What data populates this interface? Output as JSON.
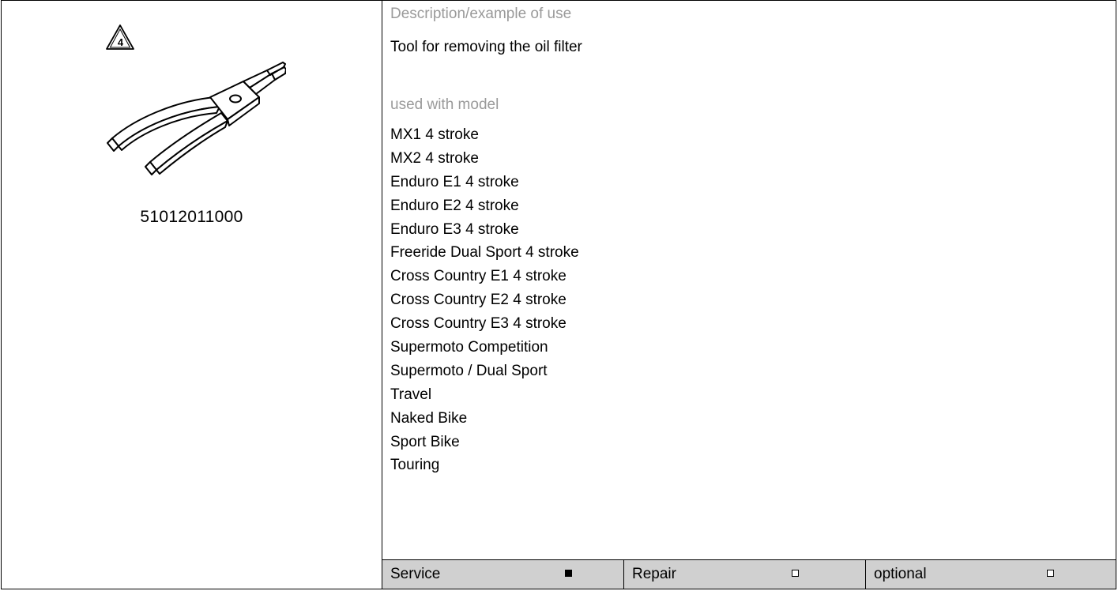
{
  "tool": {
    "part_number": "51012011000",
    "warning_symbol_number": "4",
    "description_heading": "Description/example of use",
    "description": "Tool for removing the oil filter",
    "models_heading": "used with model",
    "models": [
      "MX1 4 stroke",
      "MX2 4 stroke",
      "Enduro E1 4 stroke",
      "Enduro E2 4 stroke",
      "Enduro E3 4 stroke",
      "Freeride Dual Sport 4 stroke",
      "Cross Country E1 4 stroke",
      "Cross Country E2 4 stroke",
      "Cross Country E3 4 stroke",
      "Supermoto Competition",
      "Supermoto / Dual Sport",
      "Travel",
      "Naked Bike",
      "Sport Bike",
      "Touring"
    ]
  },
  "usage": {
    "service_label": "Service",
    "service_checked": true,
    "repair_label": "Repair",
    "repair_checked": false,
    "optional_label": "optional",
    "optional_checked": false
  },
  "icons": {
    "warning": "warning-triangle-icon",
    "tool": "circlip-pliers-illustration"
  },
  "colors": {
    "heading_gray": "#9a9a9a",
    "footer_background": "#d0d0d0",
    "border": "#000000"
  }
}
